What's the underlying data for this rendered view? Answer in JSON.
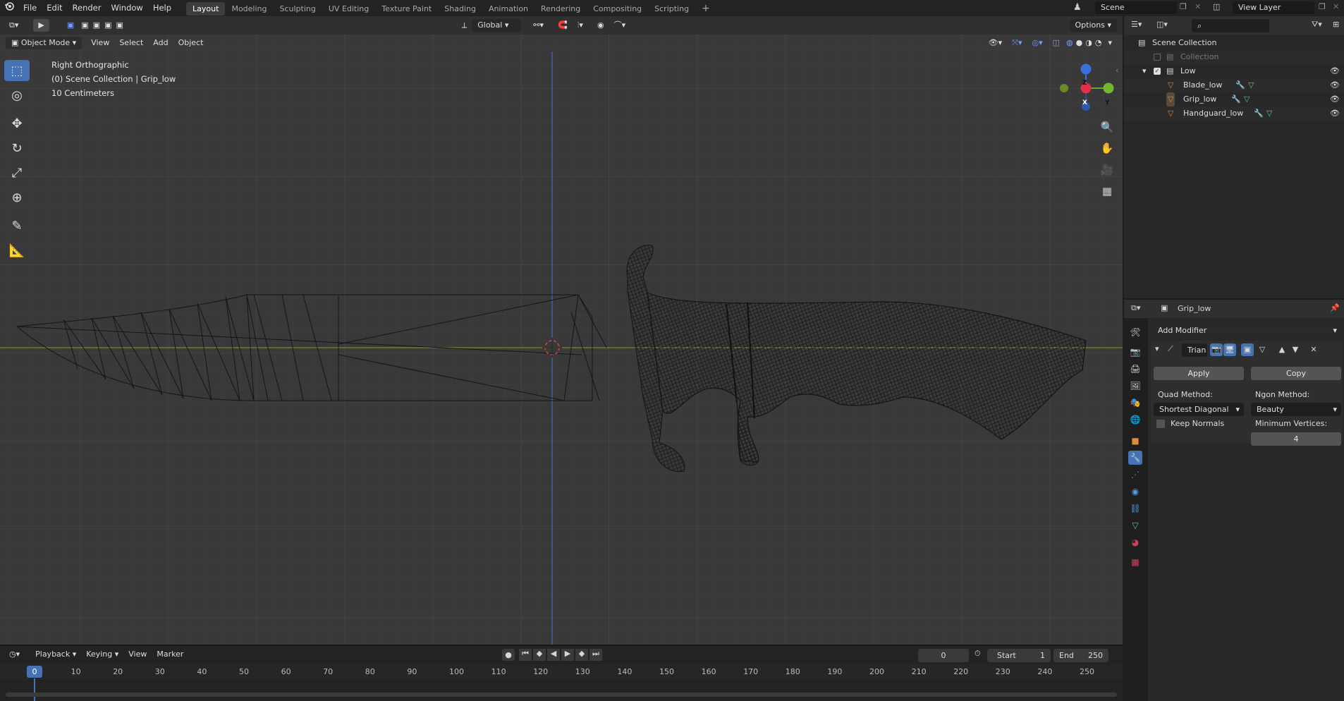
{
  "topbar": {
    "menus": [
      "File",
      "Edit",
      "Render",
      "Window",
      "Help"
    ],
    "workspaces": [
      "Layout",
      "Modeling",
      "Sculpting",
      "UV Editing",
      "Texture Paint",
      "Shading",
      "Animation",
      "Rendering",
      "Compositing",
      "Scripting"
    ],
    "active_workspace": "Layout",
    "add_tab": "+",
    "scene": "Scene",
    "view_layer": "View Layer"
  },
  "viewport_header": {
    "transform_orientation": "Global",
    "options": "Options",
    "mode": "Object Mode",
    "menus": [
      "View",
      "Select",
      "Add",
      "Object"
    ]
  },
  "viewport_info": {
    "view": "Right Orthographic",
    "collection": "(0) Scene Collection | Grip_low",
    "scale": "10 Centimeters"
  },
  "gizmo": {
    "z": "Z",
    "x": "X",
    "y": "Y"
  },
  "outliner": {
    "scene_collection": "Scene Collection",
    "items": [
      {
        "label": "Collection",
        "level": 1
      },
      {
        "label": "Low",
        "level": 1
      },
      {
        "label": "Blade_low",
        "level": 2
      },
      {
        "label": "Grip_low",
        "level": 2
      },
      {
        "label": "Handguard_low",
        "level": 2
      }
    ]
  },
  "properties": {
    "object_name": "Grip_low",
    "add_modifier": "Add Modifier",
    "modifier_name": "Trian",
    "apply": "Apply",
    "copy": "Copy",
    "quad_method_label": "Quad Method:",
    "quad_method": "Shortest Diagonal",
    "ngon_method_label": "Ngon Method:",
    "ngon_method": "Beauty",
    "keep_normals": "Keep Normals",
    "min_vertices_label": "Minimum Vertices:",
    "min_vertices": "4"
  },
  "timeline": {
    "menus": [
      "Playback",
      "Keying",
      "View",
      "Marker"
    ],
    "current_frame": "0",
    "start_label": "Start",
    "start": "1",
    "end_label": "End",
    "end": "250",
    "ruler_marks": [
      "0",
      "10",
      "20",
      "30",
      "40",
      "50",
      "60",
      "70",
      "80",
      "90",
      "100",
      "110",
      "120",
      "130",
      "140",
      "150",
      "160",
      "170",
      "180",
      "190",
      "200",
      "210",
      "220",
      "230",
      "240",
      "250"
    ]
  }
}
